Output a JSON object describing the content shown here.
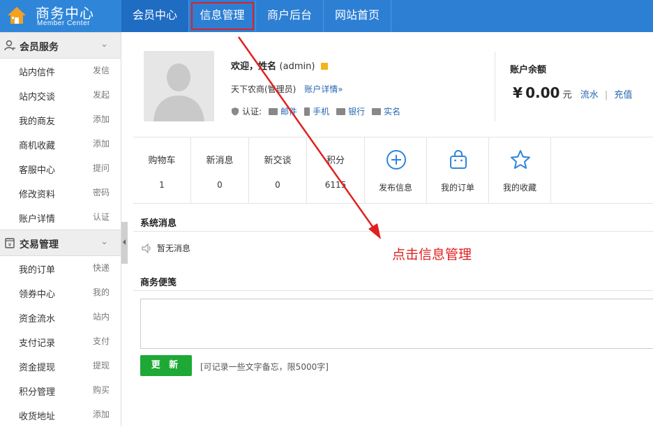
{
  "brand": {
    "title": "商务中心",
    "subtitle": "Member Center"
  },
  "nav": [
    {
      "label": "会员中心"
    },
    {
      "label": "信息管理"
    },
    {
      "label": "商户后台"
    },
    {
      "label": "网站首页"
    }
  ],
  "sidebar": {
    "group1": {
      "label": "会员服务"
    },
    "items1": [
      {
        "label": "站内信件",
        "action": "发信"
      },
      {
        "label": "站内交谈",
        "action": "发起"
      },
      {
        "label": "我的商友",
        "action": "添加"
      },
      {
        "label": "商机收藏",
        "action": "添加"
      },
      {
        "label": "客服中心",
        "action": "提问"
      },
      {
        "label": "修改资料",
        "action": "密码"
      },
      {
        "label": "账户详情",
        "action": "认证"
      }
    ],
    "group2": {
      "label": "交易管理"
    },
    "items2": [
      {
        "label": "我的订单",
        "action": "快递"
      },
      {
        "label": "领券中心",
        "action": "我的"
      },
      {
        "label": "资金流水",
        "action": "站内"
      },
      {
        "label": "支付记录",
        "action": "支付"
      },
      {
        "label": "资金提现",
        "action": "提现"
      },
      {
        "label": "积分管理",
        "action": "购买"
      },
      {
        "label": "收货地址",
        "action": "添加"
      }
    ]
  },
  "profile": {
    "welcome": "欢迎，姓名",
    "username": "(admin)",
    "company": "天下农商(管理员)",
    "account_link": "账户详情»",
    "auth_label": "认证:",
    "auth_items": [
      "邮件",
      "手机",
      "银行",
      "实名"
    ]
  },
  "balance": {
    "title": "账户余额",
    "currency": "¥",
    "amount": "0.00",
    "unit": "元",
    "link_flow": "流水",
    "separator": "|",
    "link_recharge": "充值"
  },
  "stats": [
    {
      "label": "购物车",
      "value": "1"
    },
    {
      "label": "新消息",
      "value": "0"
    },
    {
      "label": "新交谈",
      "value": "0"
    },
    {
      "label": "积分",
      "value": "6115"
    }
  ],
  "quick_links": [
    {
      "label": "发布信息",
      "icon": "plus-circle-icon"
    },
    {
      "label": "我的订单",
      "icon": "bag-icon"
    },
    {
      "label": "我的收藏",
      "icon": "star-icon"
    }
  ],
  "system": {
    "title": "系统消息",
    "empty": "暂无消息"
  },
  "memo": {
    "title": "商务便笺",
    "button": "更 新",
    "hint": "[可记录一些文字备忘，限5000字]"
  },
  "annotation": {
    "text": "点击信息管理",
    "color": "#e02020"
  },
  "colors": {
    "header": "#2d7fd4",
    "accent_link": "#2567b3",
    "button": "#1ea835"
  }
}
